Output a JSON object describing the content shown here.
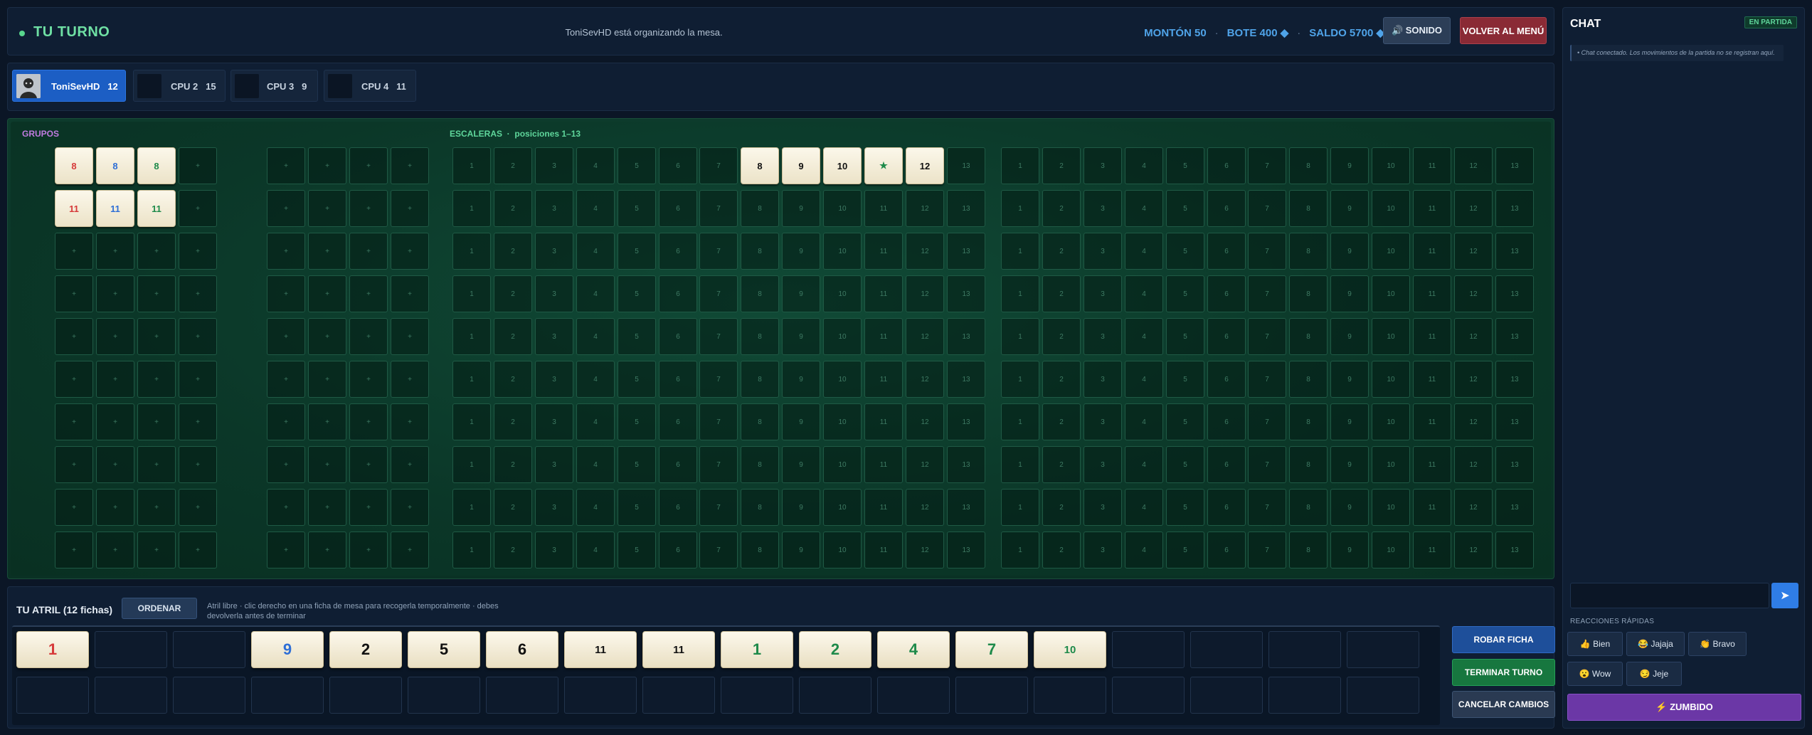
{
  "header": {
    "turn_label": "TU TURNO",
    "status": "ToniSevHD está organizando la mesa.",
    "pile": "MONTÓN 50",
    "pot": "BOTE 400 ◆",
    "balance": "SALDO 5700 ◆",
    "sound_button": "🔊 SONIDO",
    "menu_button": "VOLVER AL MENÚ"
  },
  "players": [
    {
      "name": "ToniSevHD",
      "count": "12",
      "active": true
    },
    {
      "name": "CPU 2",
      "count": "15",
      "active": false
    },
    {
      "name": "CPU 3",
      "count": "9",
      "active": false
    },
    {
      "name": "CPU 4",
      "count": "11",
      "active": false
    }
  ],
  "board": {
    "groups_label": "GRUPOS",
    "stairs_label": "ESCALERAS",
    "stairs_sub": "posiciones 1–13",
    "empty_group_symbol": "+",
    "group_rows": [
      [
        {
          "v": "8",
          "c": "#d63a3a"
        },
        {
          "v": "8",
          "c": "#2f6fd6"
        },
        {
          "v": "8",
          "c": "#1e8a4a"
        }
      ],
      [
        {
          "v": "11",
          "c": "#d63a3a"
        },
        {
          "v": "11",
          "c": "#2f6fd6"
        },
        {
          "v": "11",
          "c": "#1e8a4a"
        }
      ]
    ],
    "stair_tiles": [
      {
        "row": 0,
        "block": 0,
        "pos": 8,
        "v": "8",
        "c": "#111"
      },
      {
        "row": 0,
        "block": 0,
        "pos": 9,
        "v": "9",
        "c": "#111"
      },
      {
        "row": 0,
        "block": 0,
        "pos": 10,
        "v": "10",
        "c": "#111"
      },
      {
        "row": 0,
        "block": 0,
        "pos": 11,
        "v": "★",
        "c": "#1e8a4a"
      },
      {
        "row": 0,
        "block": 0,
        "pos": 12,
        "v": "12",
        "c": "#111"
      }
    ]
  },
  "rack": {
    "title": "TU ATRIL (12 fichas)",
    "order_button": "ORDENAR",
    "hint": "Atril libre · clic derecho en una ficha de mesa para recogerla temporalmente · debes devolverla antes de terminar",
    "tiles": [
      {
        "slot": 0,
        "v": "1",
        "c": "#d63a3a"
      },
      {
        "slot": 3,
        "v": "9",
        "c": "#2f6fd6"
      },
      {
        "slot": 4,
        "v": "2",
        "c": "#111"
      },
      {
        "slot": 5,
        "v": "5",
        "c": "#111"
      },
      {
        "slot": 6,
        "v": "6",
        "c": "#111"
      },
      {
        "slot": 7,
        "v": "11",
        "c": "#111"
      },
      {
        "slot": 8,
        "v": "11",
        "c": "#111"
      },
      {
        "slot": 9,
        "v": "1",
        "c": "#1e8a4a"
      },
      {
        "slot": 10,
        "v": "2",
        "c": "#1e8a4a"
      },
      {
        "slot": 11,
        "v": "4",
        "c": "#1e8a4a"
      },
      {
        "slot": 12,
        "v": "7",
        "c": "#1e8a4a"
      },
      {
        "slot": 13,
        "v": "10",
        "c": "#1e8a4a"
      }
    ],
    "draw_button": "ROBAR FICHA",
    "end_turn_button": "TERMINAR TURNO",
    "cancel_button": "CANCELAR CAMBIOS"
  },
  "chat": {
    "title": "CHAT",
    "badge": "EN PARTIDA",
    "messages": [
      "• Chat conectado. Los movimientos de la partida no se registran aquí."
    ],
    "send_icon": "➤",
    "quick_title": "REACCIONES RÁPIDAS",
    "reactions": [
      "👍 Bien",
      "😂 Jajaja",
      "👏 Bravo",
      "😮 Wow",
      "😏 Jeje"
    ],
    "buzz_button": "⚡ ZUMBIDO"
  },
  "colors": {
    "red": "#d63a3a",
    "blue": "#2f6fd6",
    "green": "#1e8a4a",
    "black": "#111111",
    "accent_green": "#6fe0a4"
  }
}
